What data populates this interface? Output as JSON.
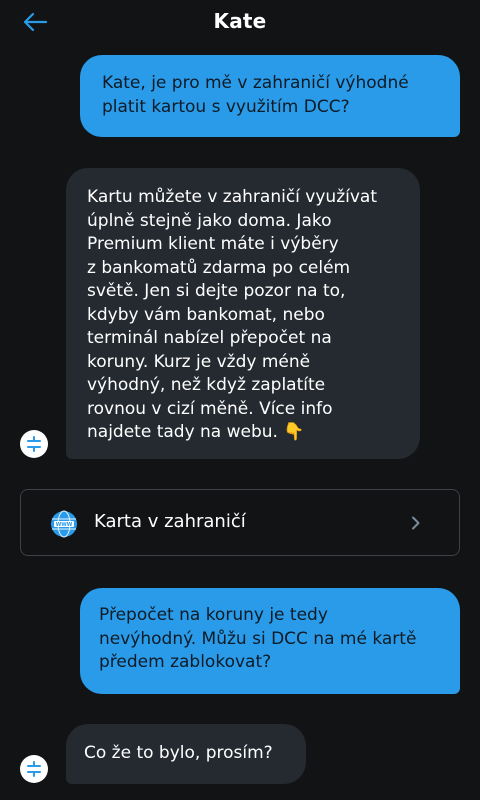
{
  "header": {
    "title": "Kate"
  },
  "messages": [
    {
      "role": "user",
      "lines": [
        "Kate, je pro mě v zahraničí výhodné",
        "platit kartou s využitím DCC?"
      ]
    },
    {
      "role": "bot",
      "lines": [
        "Kartu můžete v zahraničí využívat",
        "úplně stejně jako doma. Jako",
        "Premium klient máte i výběry",
        "z bankomatů zdarma po celém",
        "světě. Jen si dejte pozor na to,",
        "kdyby vám bankomat, nebo",
        "terminál nabízel přepočet na",
        "koruny. Kurz je vždy méně",
        "výhodný, než když zaplatíte",
        "rovnou v cizí měně. Více info",
        "najdete tady na webu. 👇"
      ]
    },
    {
      "role": "user",
      "lines": [
        "Přepočet na koruny je tedy",
        "nevýhodný. Můžu si DCC na mé kartě",
        "předem zablokovat?"
      ]
    },
    {
      "role": "bot",
      "lines": [
        "Co že to bylo, prosím?"
      ]
    }
  ],
  "link_card": {
    "label": "Karta v zahraničí",
    "icon": "www-globe-icon"
  },
  "colors": {
    "background": "#111315",
    "user_bubble": "#2a9be8",
    "bot_bubble": "#242a30",
    "card_border": "#3c4248",
    "accent": "#2a9be8"
  }
}
